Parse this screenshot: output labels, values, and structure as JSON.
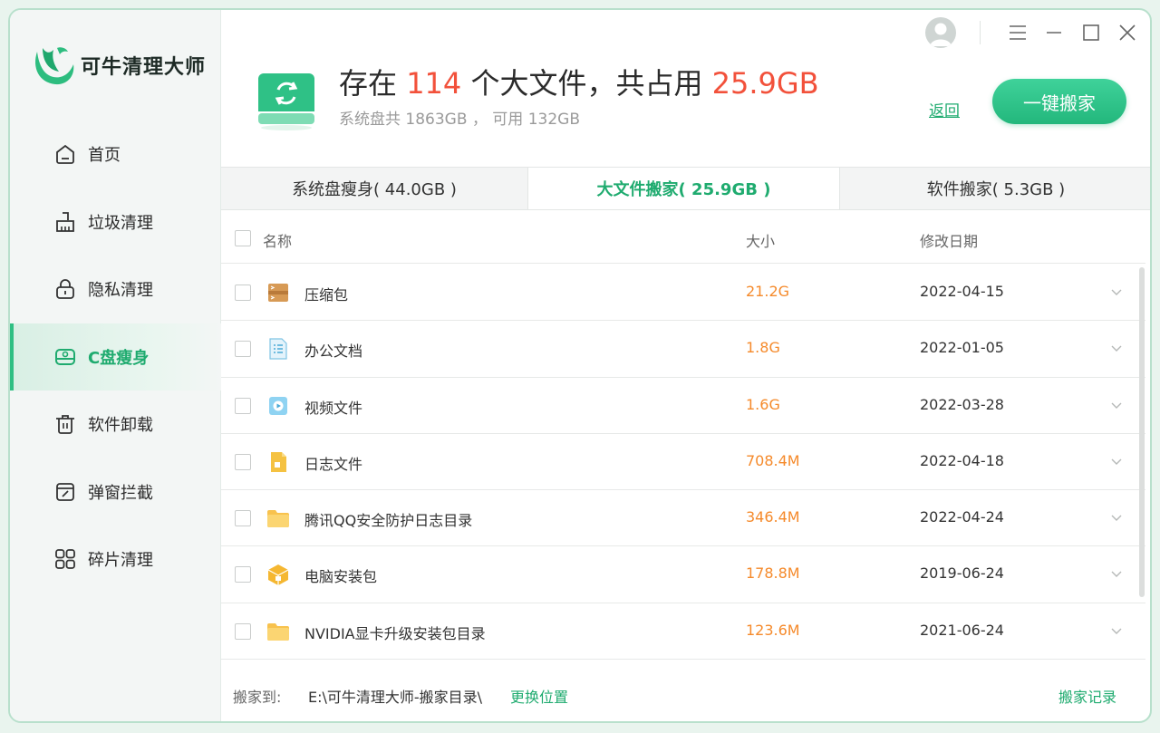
{
  "app": {
    "name": "可牛清理大师",
    "accent": "#1fab6f",
    "highlight": "#f2513b",
    "size_color": "#f58a2b"
  },
  "sidebar": {
    "items": [
      {
        "label": "首页",
        "icon": "home-icon",
        "active": false
      },
      {
        "label": "垃圾清理",
        "icon": "broom-icon",
        "active": false
      },
      {
        "label": "隐私清理",
        "icon": "lock-icon",
        "active": false
      },
      {
        "label": "C盘瘦身",
        "icon": "disk-icon",
        "active": true
      },
      {
        "label": "软件卸载",
        "icon": "trash-icon",
        "active": false
      },
      {
        "label": "弹窗拦截",
        "icon": "popup-block-icon",
        "active": false
      },
      {
        "label": "碎片清理",
        "icon": "grid-icon",
        "active": false
      }
    ]
  },
  "header": {
    "title_prefix": "存在",
    "file_count": "114",
    "title_mid": "个大文件，共占用",
    "total_size": "25.9GB",
    "subtitle": "系统盘共 1863GB ， 可用 132GB",
    "back_label": "返回",
    "primary_label": "一键搬家"
  },
  "tabs": [
    {
      "label": "系统盘瘦身( 44.0GB )",
      "active": false
    },
    {
      "label": "大文件搬家( 25.9GB )",
      "active": true
    },
    {
      "label": "软件搬家( 5.3GB )",
      "active": false
    }
  ],
  "table": {
    "headers": {
      "name": "名称",
      "size": "大小",
      "date": "修改日期"
    },
    "rows": [
      {
        "name": "压缩包",
        "size": "21.2G",
        "date": "2022-04-15",
        "icon": "archive-icon"
      },
      {
        "name": "办公文档",
        "size": "1.8G",
        "date": "2022-01-05",
        "icon": "document-icon"
      },
      {
        "name": "视频文件",
        "size": "1.6G",
        "date": "2022-03-28",
        "icon": "video-icon"
      },
      {
        "name": "日志文件",
        "size": "708.4M",
        "date": "2022-04-18",
        "icon": "log-icon"
      },
      {
        "name": "腾讯QQ安全防护日志目录",
        "size": "346.4M",
        "date": "2022-04-24",
        "icon": "folder-icon"
      },
      {
        "name": "电脑安装包",
        "size": "178.8M",
        "date": "2019-06-24",
        "icon": "package-icon"
      },
      {
        "name": "NVIDIA显卡升级安装包目录",
        "size": "123.6M",
        "date": "2021-06-24",
        "icon": "folder-icon"
      }
    ]
  },
  "footer": {
    "move_to_label": "搬家到:",
    "path": "E:\\可牛清理大师-搬家目录\\",
    "change_label": "更换位置",
    "record_label": "搬家记录"
  }
}
